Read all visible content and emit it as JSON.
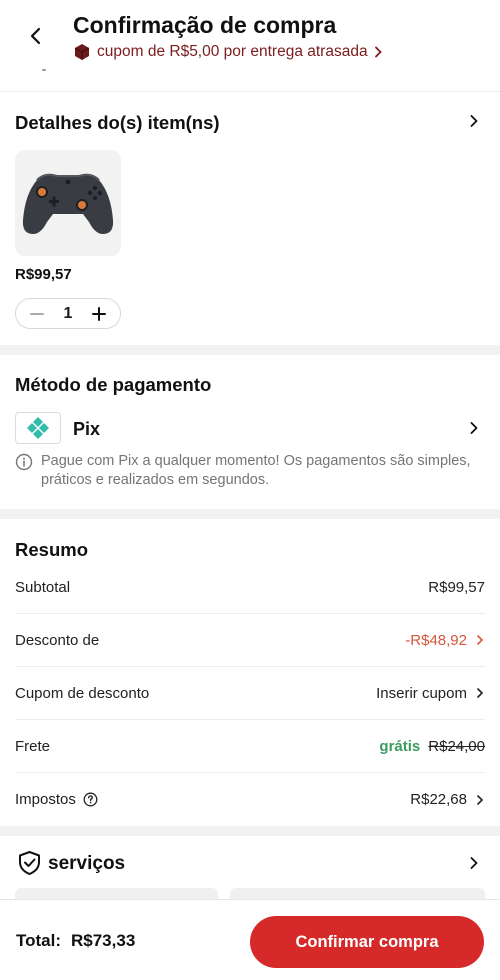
{
  "header": {
    "title": "Confirmação de compra",
    "coupon_banner": "cupom de R$5,00 por entrega atrasada"
  },
  "items": {
    "title": "Detalhes do(s) item(ns)",
    "product": {
      "price": "R$99,57",
      "quantity": "1"
    }
  },
  "payment": {
    "title": "Método de pagamento",
    "method": "Pix",
    "note": "Pague com Pix a qualquer momento! Os pagamentos são simples, práticos e realizados em segundos."
  },
  "summary": {
    "title": "Resumo",
    "rows": [
      {
        "label": "Subtotal",
        "value": "R$99,57"
      },
      {
        "label": "Desconto de",
        "value": "-R$48,92"
      },
      {
        "label": "Cupom de desconto",
        "value": "Inserir cupom"
      },
      {
        "label": "Frete",
        "free": "grátis",
        "value": "R$24,00"
      },
      {
        "label": "Impostos",
        "value": "R$22,68"
      }
    ]
  },
  "services": {
    "title": "serviços"
  },
  "footer": {
    "total_label": "Total:",
    "total_value": "R$73,33",
    "confirm_label": "Confirmar compra"
  },
  "colors": {
    "primary": "#d62a2a",
    "discount": "#d4563c",
    "free": "#3d9b5e",
    "coupon_banner": "#7a1d1d",
    "pix": "#32bcad"
  }
}
